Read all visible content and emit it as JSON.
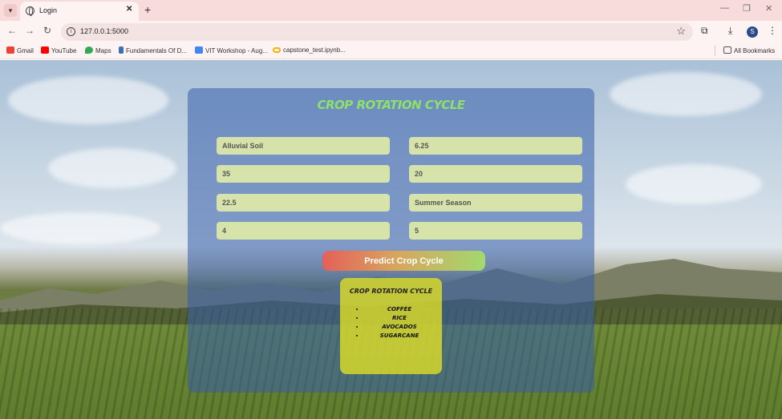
{
  "browser": {
    "tab_title": "Login",
    "url": "127.0.0.1:5000",
    "profile_initial": "S",
    "bookmarks": [
      {
        "label": "Gmail",
        "color": "#ea4335"
      },
      {
        "label": "YouTube",
        "color": "#ff0000"
      },
      {
        "label": "Maps",
        "color": "#34a853"
      },
      {
        "label": "Fundamentals Of D...",
        "color": "#3b6fb6"
      },
      {
        "label": "VIT Workshop - Aug...",
        "color": "#4285f4"
      },
      {
        "label": "capstone_test.ipynb...",
        "color": "#f4b400"
      }
    ],
    "all_bookmarks": "All Bookmarks"
  },
  "page": {
    "title": "CROP ROTATION CYCLE",
    "fields": [
      {
        "value": "Alluvial Soil"
      },
      {
        "value": "6.25"
      },
      {
        "value": "35"
      },
      {
        "value": "20"
      },
      {
        "value": "22.5"
      },
      {
        "value": "Summer Season"
      },
      {
        "value": "4"
      },
      {
        "value": "5"
      }
    ],
    "predict_label": "Predict Crop Cycle",
    "result": {
      "title": "CROP ROTATION CYCLE",
      "crops": [
        "COFFEE",
        "RICE",
        "AVOCADOS",
        "SUGARCANE"
      ]
    }
  },
  "colors": {
    "card": "#345caa",
    "title": "#8ee06a",
    "field": "#e2eea6",
    "result": "#dcdc28"
  }
}
